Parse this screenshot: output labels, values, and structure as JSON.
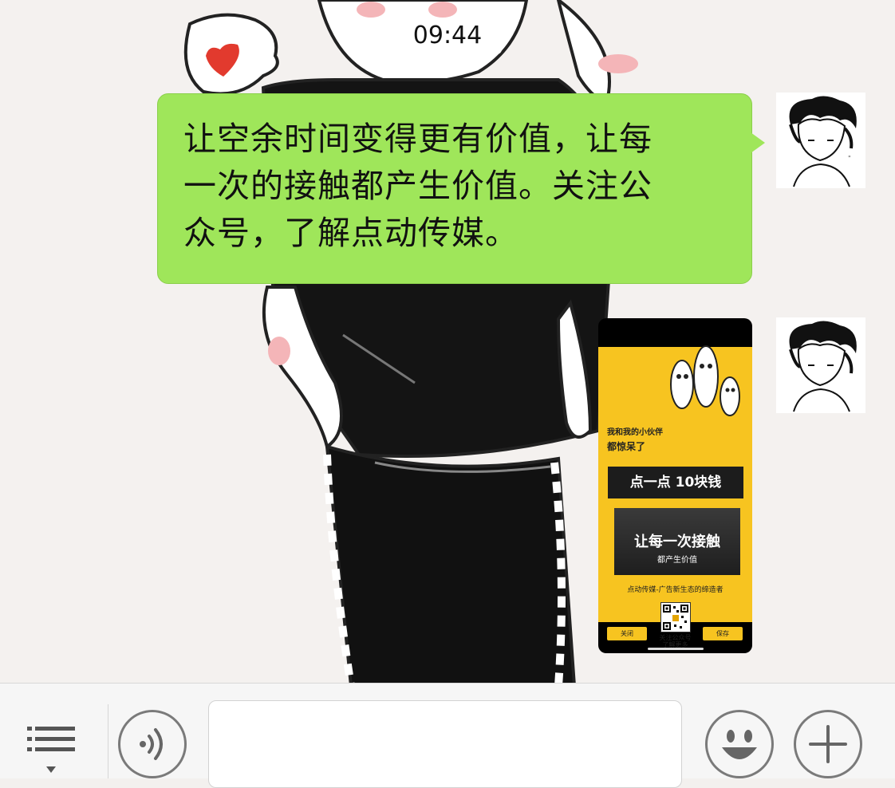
{
  "chat": {
    "timestamp": "09:44",
    "messages": [
      {
        "type": "text",
        "from": "me",
        "text_lines": [
          "让空余时间变得更有价值，让每",
          "一次的接触都产生价值。关注公",
          "众号，了解点动传媒。"
        ]
      },
      {
        "type": "image",
        "from": "me",
        "poster": {
          "kicker": "我和我的小伙伴",
          "kicker2": "都惊呆了",
          "band": "点一点 10块钱",
          "headline": "让每一次接触",
          "subheadline": "都产生价值",
          "slogan": "点动传媒-广告新生态的缔造者",
          "follow_line1": "关注公众号",
          "follow_line2": "了解更多",
          "close_label": "关闭",
          "save_label": "保存"
        }
      }
    ]
  },
  "input_bar": {
    "menu_icon": "list-menu-icon",
    "voice_icon": "voice-icon",
    "emoji_icon": "smiley-icon",
    "plus_icon": "plus-icon",
    "input_value": ""
  },
  "colors": {
    "bubble_green": "#9fe65a",
    "poster_yellow": "#f7c420",
    "input_bar_bg": "#f6f6f6"
  }
}
